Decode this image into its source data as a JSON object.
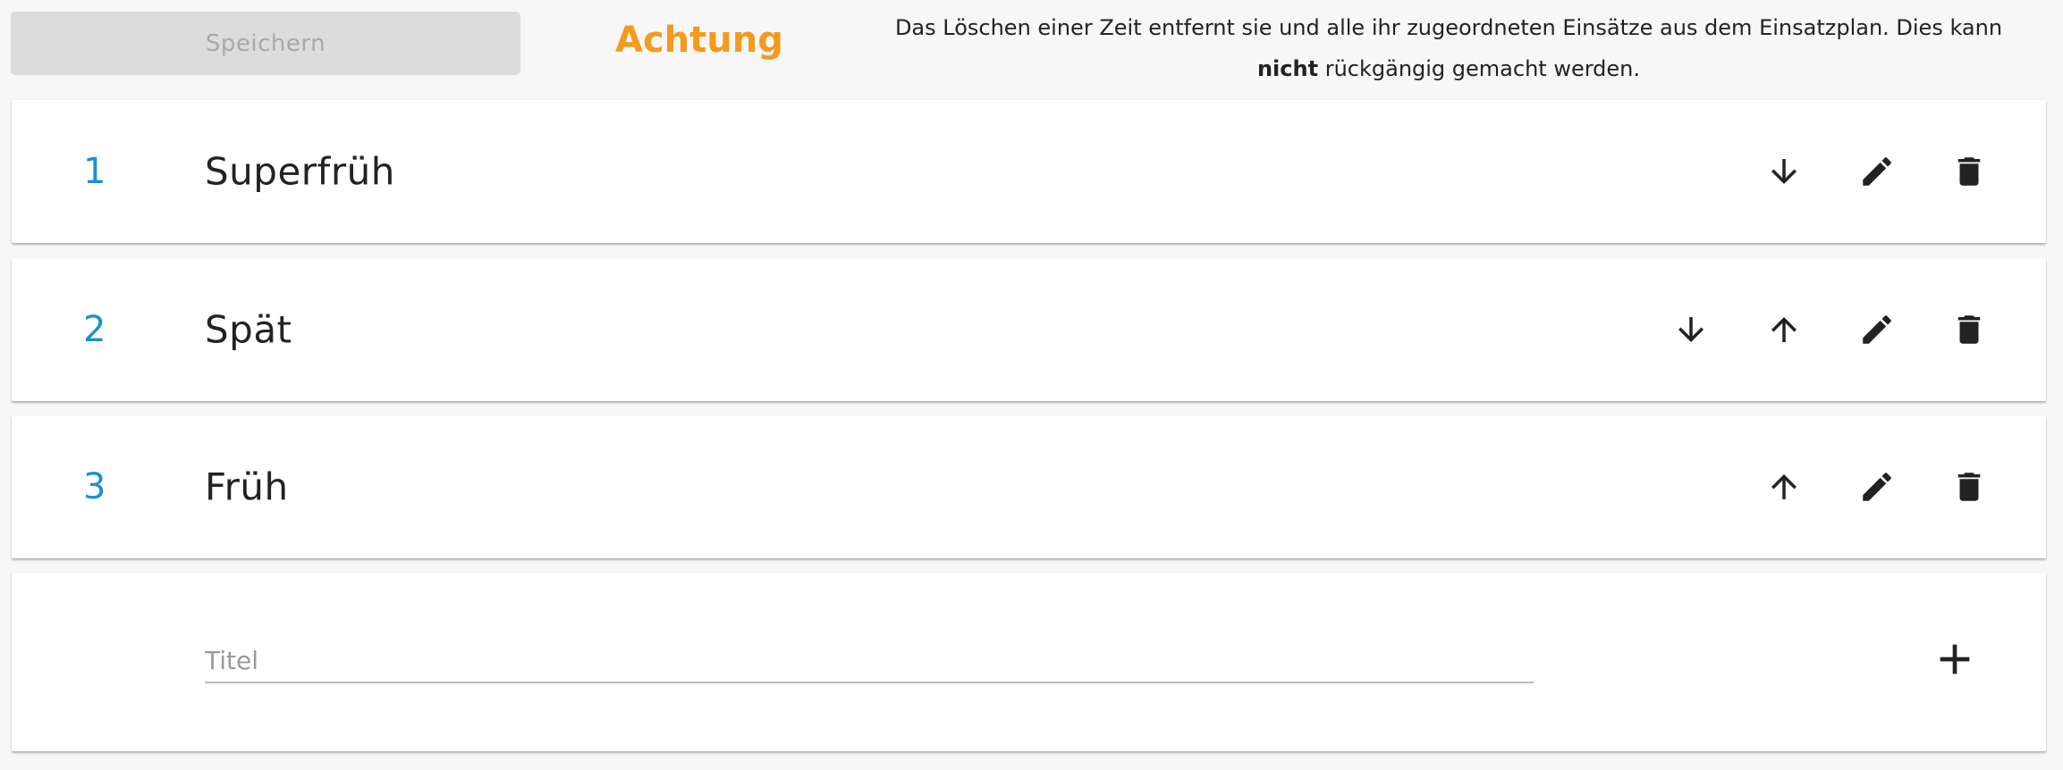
{
  "header": {
    "save_label": "Speichern",
    "warning_title": "Achtung",
    "warning_text_before": "Das Löschen einer Zeit entfernt sie und alle ihr zugeordneten Einsätze aus dem Einsatzplan. Dies kann ",
    "warning_text_bold": "nicht",
    "warning_text_after": " rückgängig gemacht werden."
  },
  "rows": [
    {
      "number": "1",
      "title": "Superfrüh",
      "actions": [
        "arrow-down-icon",
        "pencil-icon",
        "trash-icon"
      ]
    },
    {
      "number": "2",
      "title": "Spät",
      "actions": [
        "arrow-down-icon",
        "arrow-up-icon",
        "pencil-icon",
        "trash-icon"
      ]
    },
    {
      "number": "3",
      "title": "Früh",
      "actions": [
        "arrow-up-icon",
        "pencil-icon",
        "trash-icon"
      ]
    }
  ],
  "new_entry": {
    "placeholder": "Titel",
    "value": "",
    "add_icon": "plus-icon"
  },
  "colors": {
    "accent_number": "#1c8fd1",
    "warning": "#f59a1c",
    "disabled_button": "#dcdcdc"
  }
}
